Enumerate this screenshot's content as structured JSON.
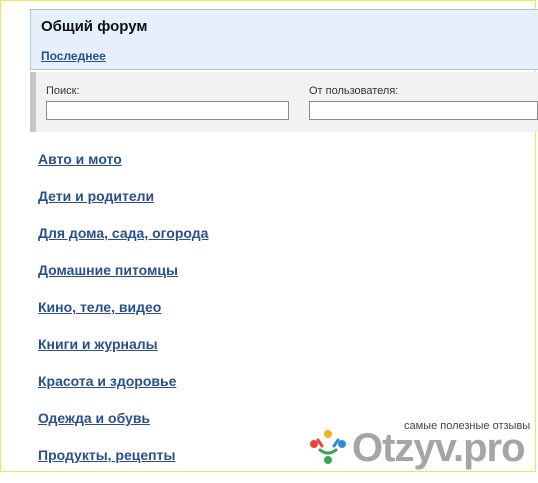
{
  "forum": {
    "title": "Общий форум",
    "latest_link": "Последнее"
  },
  "search": {
    "query_label": "Поиск:",
    "query_value": "",
    "user_label": "От пользователя:",
    "user_value": ""
  },
  "categories": [
    "Авто и мото",
    "Дети и родители",
    "Для дома, сада, огорода",
    "Домашние питомцы",
    "Кино, теле, видео",
    "Книги и журналы",
    "Красота и здоровье",
    "Одежда и обувь",
    "Продукты, рецепты"
  ],
  "watermark": {
    "slogan": "самые полезные отзывы",
    "logo_text": "Otzyv.pro",
    "logo_colors": [
      "#e8453c",
      "#3aa655",
      "#f2b01e",
      "#2f8fd6"
    ]
  },
  "colors": {
    "link": "#2a4f8f",
    "header_bg": "#e5f0fb",
    "header_border": "#a8c5e4",
    "panel_bg": "#f2f2f2"
  }
}
